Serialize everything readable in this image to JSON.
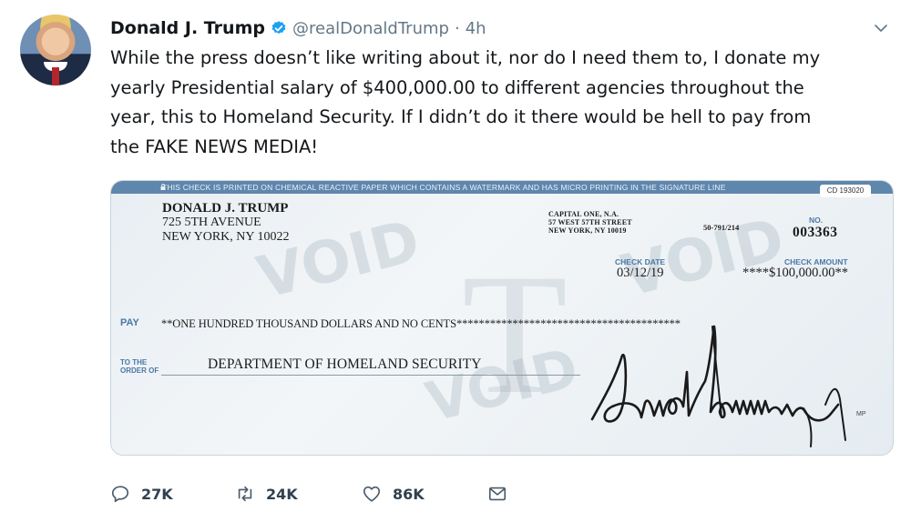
{
  "tweet": {
    "author": {
      "display_name": "Donald J. Trump",
      "handle": "@realDonaldTrump",
      "separator": "·",
      "time": "4h"
    },
    "icons": {
      "verified": "verified-badge-icon",
      "menu": "chevron-down-icon"
    },
    "text": "While the press doesn’t like writing about it, nor do I need them to, I donate my\nyearly Presidential salary of $400,000.00 to different agencies throughout the\nyear, this to Homeland Security. If I didn’t do it there would be hell to pay from\nthe FAKE NEWS MEDIA!",
    "accent_color": "#1da1f2"
  },
  "check": {
    "security_band": "THIS CHECK IS PRINTED ON CHEMICAL REACTIVE PAPER WHICH CONTAINS A WATERMARK AND HAS MICRO PRINTING IN THE SIGNATURE LINE",
    "band_code": "CD 193020",
    "payor": {
      "name": "DONALD J. TRUMP",
      "address1": "725 5TH AVENUE",
      "address2": "NEW YORK, NY 10022"
    },
    "bank": {
      "line1": "CAPITAL ONE, N.A.",
      "line2": "57 WEST 57TH STREET",
      "line3": "NEW YORK, NY 10019"
    },
    "routing": "50-791/214",
    "no_label": "NO.",
    "number": "003363",
    "date_label": "CHECK DATE",
    "date": "03/12/19",
    "amount_label": "CHECK AMOUNT",
    "amount": "****$100,000.00**",
    "pay_label": "PAY",
    "pay_words": "**ONE HUNDRED THOUSAND  DOLLARS AND NO CENTS****************************************",
    "order_label_1": "TO THE",
    "order_label_2": "ORDER OF",
    "payee": "DEPARTMENT OF HOMELAND SECURITY",
    "watermark": "VOID",
    "watermark_letter": "T",
    "micro_print": "MP",
    "band_color": "#5f86ad",
    "label_color": "#4b78a6"
  },
  "actions": {
    "reply": {
      "icon": "reply-icon",
      "count": "27K"
    },
    "retweet": {
      "icon": "retweet-icon",
      "count": "24K"
    },
    "like": {
      "icon": "heart-icon",
      "count": "86K"
    },
    "message": {
      "icon": "envelope-icon"
    }
  }
}
